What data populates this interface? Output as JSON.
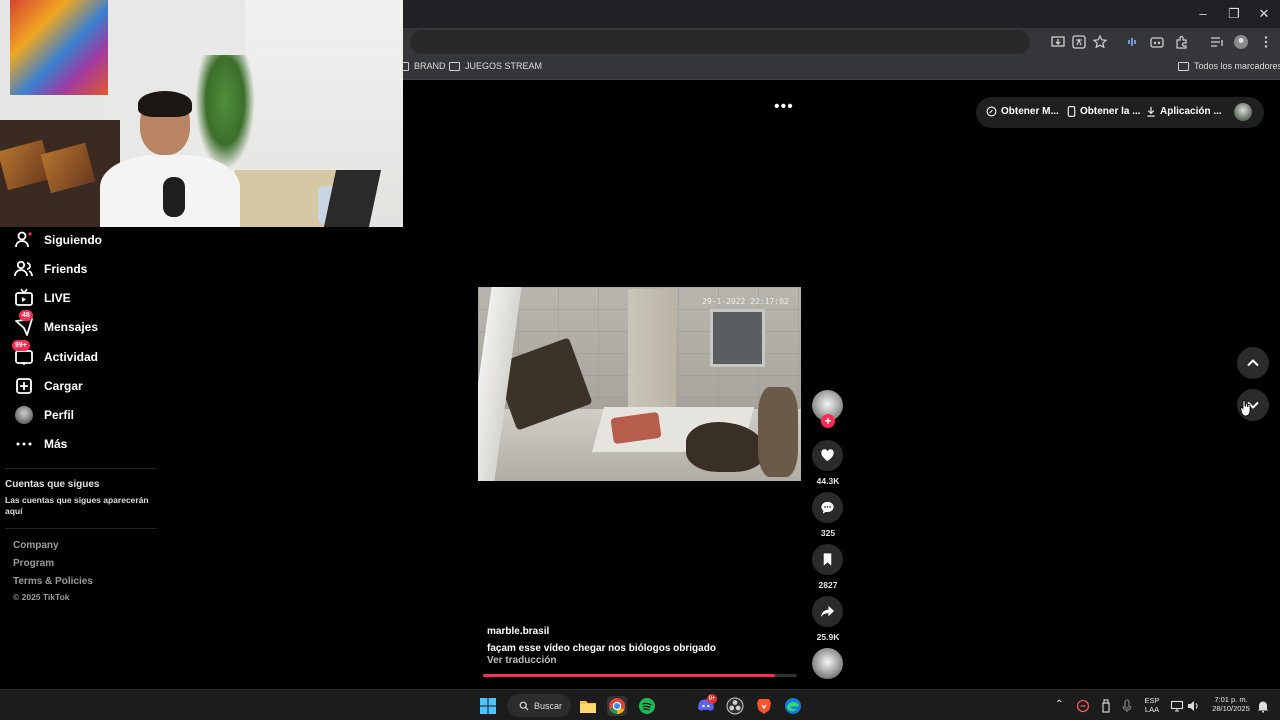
{
  "bookmarks": {
    "items": [
      "BRAND",
      "JUEGOS STREAM"
    ],
    "all": "Todos los marcadores"
  },
  "sidebar": {
    "items": [
      {
        "label": "Siguiendo",
        "icon": "following-icon"
      },
      {
        "label": "Friends",
        "icon": "friends-icon"
      },
      {
        "label": "LIVE",
        "icon": "live-tv-icon"
      },
      {
        "label": "Mensajes",
        "icon": "messages-icon",
        "badge": "48"
      },
      {
        "label": "Actividad",
        "icon": "activity-icon",
        "badge": "99+"
      },
      {
        "label": "Cargar",
        "icon": "upload-icon"
      },
      {
        "label": "Perfil",
        "icon": "profile-avatar"
      },
      {
        "label": "Más",
        "icon": "more-icon"
      }
    ],
    "following_title": "Cuentas que sigues",
    "following_sub": "Las cuentas que sigues aparecerán aquí",
    "footer": [
      "Company",
      "Program",
      "Terms & Policies"
    ],
    "copyright": "© 2025 TikTok"
  },
  "topbar": {
    "get_m": "Obtener M...",
    "get_app": "Obtener la ...",
    "application": "Aplicación ..."
  },
  "video": {
    "timestamp": "29-1-2022 22:17:02",
    "username": "marble.brasil",
    "caption": "façam esse vídeo chegar nos biólogos obrigado",
    "translate": "Ver traducción",
    "progress": 0.93
  },
  "actions": {
    "likes": "44.3K",
    "comments": "325",
    "saves": "2827",
    "shares": "25.9K"
  },
  "taskbar": {
    "search": "Buscar",
    "lang_top": "ESP",
    "lang_bottom": "LAA",
    "time": "7:01 p. m.",
    "date": "28/10/2025",
    "discord_badge": "9+"
  },
  "colors": {
    "accent": "#fe2c55",
    "background": "#000000",
    "chrome": "#35363a"
  }
}
